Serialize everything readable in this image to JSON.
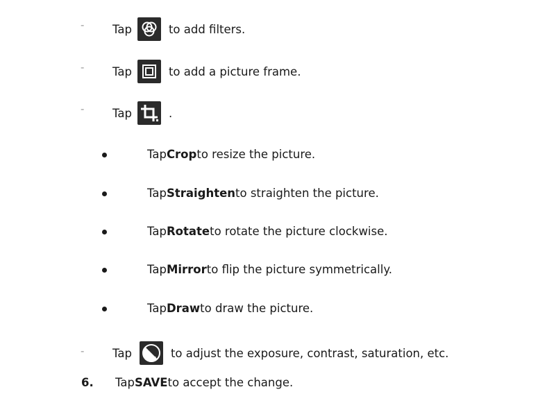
{
  "steps": [
    {
      "dash": "-",
      "tap": "Tap",
      "rest": "to add filters.",
      "icon": "filter-circles-icon"
    },
    {
      "dash": "-",
      "tap": "Tap",
      "rest": "to add a picture frame.",
      "icon": "picture-frame-icon"
    },
    {
      "dash": "-",
      "tap": "Tap",
      "rest": ".",
      "icon": "crop-icon"
    },
    {
      "dash": "-",
      "tap": "Tap",
      "rest": "to adjust the exposure, contrast, saturation, etc.",
      "icon": "exposure-icon"
    }
  ],
  "crop_options": [
    {
      "pre": "Tap ",
      "bold": "Crop",
      "post": " to resize the picture."
    },
    {
      "pre": "Tap ",
      "bold": "Straighten",
      "post": " to straighten the picture."
    },
    {
      "pre": "Tap ",
      "bold": "Rotate",
      "post": " to rotate the picture clockwise."
    },
    {
      "pre": "Tap ",
      "bold": "Mirror",
      "post": " to flip the picture symmetrically."
    },
    {
      "pre": "Tap ",
      "bold": "Draw",
      "post": " to draw the picture."
    }
  ],
  "final_step": {
    "number": "6.",
    "pre": "Tap ",
    "bold": "SAVE",
    "post": " to accept the change."
  },
  "colors": {
    "icon_bg": "#2b2b2b",
    "icon_fg": "#ffffff",
    "text": "#1a1a1a",
    "dash": "#9a9a9a"
  }
}
